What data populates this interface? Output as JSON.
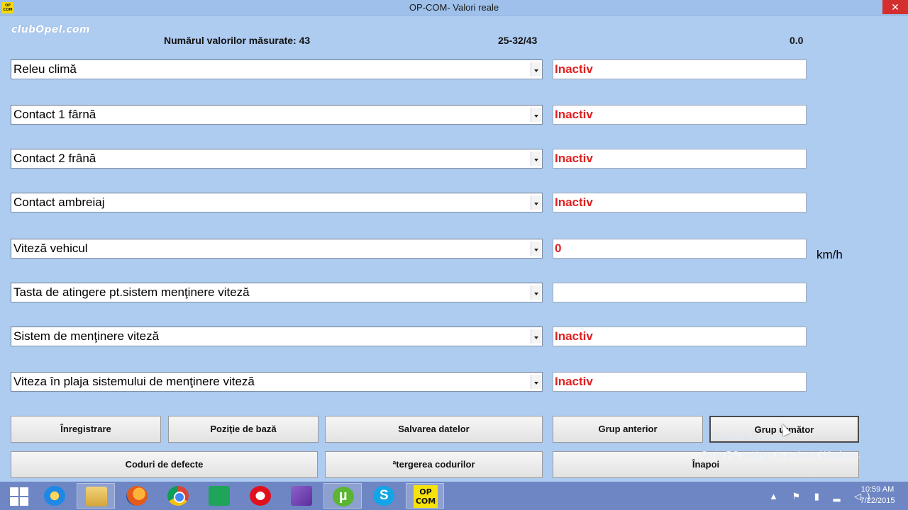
{
  "window": {
    "title": "OP-COM- Valori reale",
    "app_icon_text": "OP COM",
    "close_label": "✕"
  },
  "logo": {
    "text": "clubOpel.com"
  },
  "header": {
    "count_label": "Numărul valorilor măsurate: 43",
    "range": "25-32/43",
    "value": "0.0"
  },
  "rows": [
    {
      "label": "Releu climă",
      "value": "Inactiv",
      "unit": ""
    },
    {
      "label": "Contact 1 fârnă",
      "value": "Inactiv",
      "unit": ""
    },
    {
      "label": "Contact 2 frână",
      "value": "Inactiv",
      "unit": ""
    },
    {
      "label": "Contact ambreiaj",
      "value": "Inactiv",
      "unit": ""
    },
    {
      "label": "Viteză vehicul",
      "value": "0",
      "unit": "km/h"
    },
    {
      "label": "Tasta de atingere pt.sistem menţinere viteză",
      "value": "",
      "unit": ""
    },
    {
      "label": "Sistem de menţinere viteză",
      "value": "Inactiv",
      "unit": ""
    },
    {
      "label": "Viteza în plaja sistemului de menţinere viteză",
      "value": "Inactiv",
      "unit": ""
    }
  ],
  "buttons": {
    "record": "Înregistrare",
    "base_position": "Poziţie de bază",
    "save_data": "Salvarea datelor",
    "prev_group": "Grup anterior",
    "next_group": "Grup următor",
    "fault_codes": "Coduri de defecte",
    "clear_codes": "ªtergerea codurilor",
    "back": "Înapoi"
  },
  "watermark": {
    "line1": "Activate Windows",
    "line2": "Go to PC settings to activate Windows."
  },
  "taskbar": {
    "apps": [
      "start-icon",
      "internet-explorer-icon",
      "file-explorer-icon",
      "firefox-icon",
      "chrome-icon",
      "store-icon",
      "opera-icon",
      "visual-studio-icon",
      "utorrent-icon",
      "skype-icon",
      "opcom-icon"
    ],
    "opcom_label": "OP COM",
    "tray_symbols": "▲ ⚑ ▮ ▂ ◁)",
    "time": "10:59 AM",
    "date": "7/22/2015"
  },
  "colors": {
    "background": "#aecbf0",
    "value_text": "#e02020",
    "taskbar": "#6e86c3"
  }
}
